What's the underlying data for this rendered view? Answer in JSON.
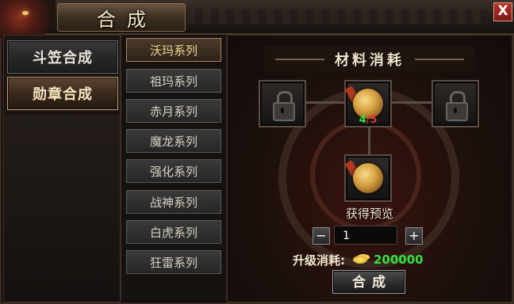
{
  "window": {
    "title": "合成",
    "close_glyph": "X"
  },
  "categories": [
    {
      "label": "斗笠合成",
      "active": false
    },
    {
      "label": "勋章合成",
      "active": true
    }
  ],
  "series": [
    {
      "label": "沃玛系列",
      "active": true
    },
    {
      "label": "祖玛系列",
      "active": false
    },
    {
      "label": "赤月系列",
      "active": false
    },
    {
      "label": "魔龙系列",
      "active": false
    },
    {
      "label": "强化系列",
      "active": false
    },
    {
      "label": "战神系列",
      "active": false
    },
    {
      "label": "白虎系列",
      "active": false
    },
    {
      "label": "狂雷系列",
      "active": false
    }
  ],
  "materials": {
    "heading": "材料消耗",
    "slots": [
      {
        "state": "locked",
        "icon": "lock-icon"
      },
      {
        "state": "item",
        "icon": "medal-icon",
        "have": "4",
        "sep": "/",
        "need": "5"
      },
      {
        "state": "locked",
        "icon": "lock-icon"
      }
    ]
  },
  "preview": {
    "label": "获得预览",
    "icon": "medal-icon"
  },
  "quantity": {
    "minus": "−",
    "value": "1",
    "plus": "+"
  },
  "cost": {
    "label": "升级消耗:",
    "currency_icon": "gold-ingot-icon",
    "value": "200000"
  },
  "action": {
    "label": "合成"
  },
  "colors": {
    "have": "#36e040",
    "need": "#e03a30",
    "cost": "#36e040",
    "accent": "#f0d98c"
  }
}
